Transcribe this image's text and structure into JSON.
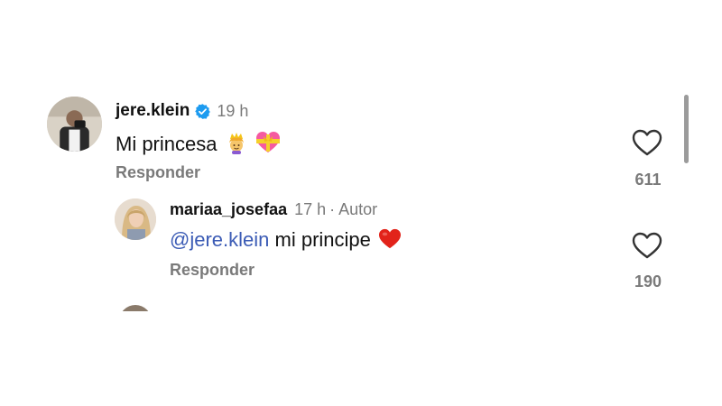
{
  "comments": [
    {
      "username": "jere.klein",
      "verified": true,
      "time": "19 h",
      "text": "Mi princesa",
      "emojis": [
        "crown-princess-emoji",
        "heart-ribbon-emoji"
      ],
      "reply_label": "Responder",
      "likes": "611",
      "like_icon": "heart-outline-icon"
    },
    {
      "username": "mariaa_josefaa",
      "time": "17 h",
      "author_tag": "Autor",
      "mention": "@jere.klein",
      "text": " mi principe",
      "emojis": [
        "red-heart-emoji"
      ],
      "reply_label": "Responder",
      "likes": "190",
      "like_icon": "heart-outline-icon"
    }
  ],
  "colors": {
    "mention": "#3b5bb5",
    "verified_badge": "#1d9bf0",
    "secondary_text": "#7a7a7a"
  }
}
